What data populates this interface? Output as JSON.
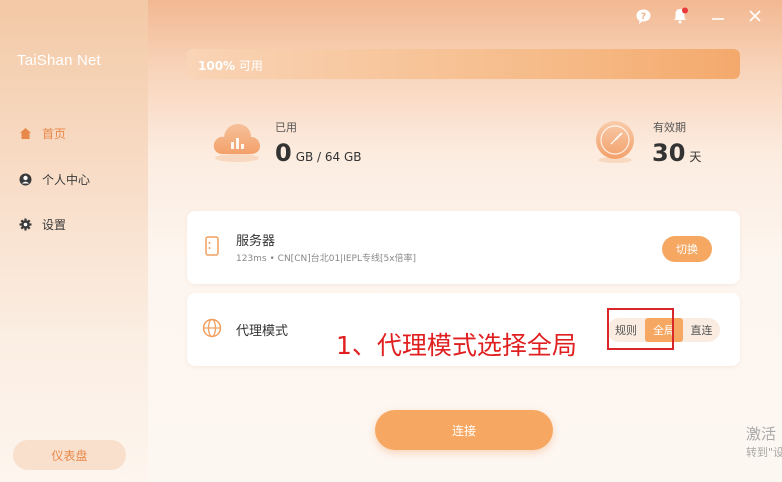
{
  "app": {
    "title": "TaiShan Net"
  },
  "sidebar": {
    "items": [
      {
        "label": "首页",
        "icon": "home-icon",
        "active": true
      },
      {
        "label": "个人中心",
        "icon": "user-icon",
        "active": false
      },
      {
        "label": "设置",
        "icon": "gear-icon",
        "active": false
      }
    ],
    "dashboard_label": "仪表盘"
  },
  "window_controls": {
    "icons": [
      "help-icon",
      "bell-icon",
      "minimize-icon",
      "close-icon"
    ],
    "notification_dot": true
  },
  "traffic_bar": {
    "percent": 100,
    "percent_text": "100%",
    "suffix": "可用"
  },
  "usage": {
    "label": "已用",
    "value": "0",
    "unit": "GB / 64 GB"
  },
  "validity": {
    "label": "有效期",
    "value": "30",
    "unit": "天"
  },
  "server": {
    "title": "服务器",
    "subtitle": "123ms • CN[CN]台北01|IEPL专线[5x倍率]",
    "switch_label": "切换"
  },
  "proxy": {
    "title": "代理模式",
    "modes": [
      "规则",
      "全局",
      "直连"
    ],
    "selected": "全局"
  },
  "annotation": "1、代理模式选择全局",
  "connect_label": "连接",
  "watermark": {
    "line1": "激活",
    "line2": "转到\"设"
  },
  "colors": {
    "accent": "#f6a862",
    "highlight_box": "#d9262b",
    "annotation_text": "#e02020"
  }
}
